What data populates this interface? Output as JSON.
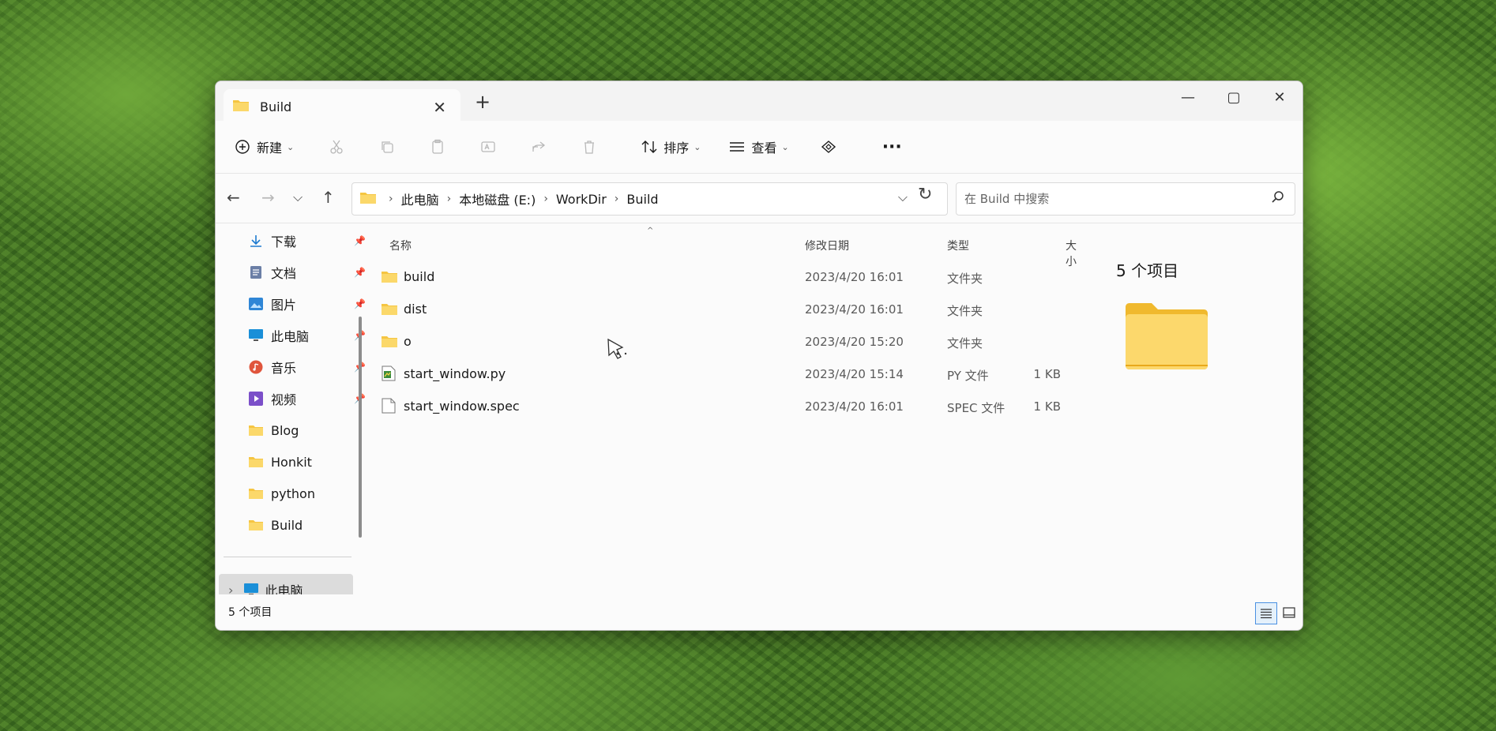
{
  "window": {
    "tab_title": "Build",
    "tab_close": "✕",
    "new_tab": "+",
    "controls": {
      "minimize": "—",
      "maximize": "▢",
      "close": "✕"
    }
  },
  "toolbar": {
    "new_label": "新建",
    "sort_label": "排序",
    "view_label": "查看",
    "more_label": "···",
    "icons": [
      "add-icon",
      "cut-icon",
      "copy-icon",
      "paste-icon",
      "rename-icon",
      "share-icon",
      "delete-icon",
      "sort-icon",
      "view-icon",
      "filter-icon",
      "more-icon"
    ]
  },
  "address": {
    "crumbs": [
      "此电脑",
      "本地磁盘 (E:)",
      "WorkDir",
      "Build"
    ],
    "dropdown": "⌵",
    "refresh": "↻"
  },
  "search": {
    "placeholder": "在 Build 中搜索"
  },
  "sidebar": {
    "items": [
      {
        "label": "下载",
        "icon": "download-icon",
        "pinned": true
      },
      {
        "label": "文档",
        "icon": "document-icon",
        "pinned": true
      },
      {
        "label": "图片",
        "icon": "picture-icon",
        "pinned": true
      },
      {
        "label": "此电脑",
        "icon": "computer-icon",
        "pinned": true
      },
      {
        "label": "音乐",
        "icon": "music-icon",
        "pinned": true
      },
      {
        "label": "视频",
        "icon": "video-icon",
        "pinned": true
      },
      {
        "label": "Blog",
        "icon": "folder-icon",
        "pinned": false
      },
      {
        "label": "Honkit",
        "icon": "folder-icon",
        "pinned": false
      },
      {
        "label": "python",
        "icon": "folder-icon",
        "pinned": false
      },
      {
        "label": "Build",
        "icon": "folder-icon",
        "pinned": false
      }
    ],
    "this_pc": "此电脑",
    "expand": "›"
  },
  "columns": {
    "name": "名称",
    "date": "修改日期",
    "type": "类型",
    "size": "大小",
    "sort_caret": "^"
  },
  "files": [
    {
      "name": "build",
      "date": "2023/4/20 16:01",
      "type": "文件夹",
      "size": ""
    },
    {
      "name": "dist",
      "date": "2023/4/20 16:01",
      "type": "文件夹",
      "size": ""
    },
    {
      "name": "o",
      "date": "2023/4/20 15:20",
      "type": "文件夹",
      "size": ""
    },
    {
      "name": "start_window.py",
      "date": "2023/4/20 15:14",
      "type": "PY 文件",
      "size": "1 KB"
    },
    {
      "name": "start_window.spec",
      "date": "2023/4/20 16:01",
      "type": "SPEC 文件",
      "size": "1 KB"
    }
  ],
  "details": {
    "title": "5 个项目"
  },
  "status": {
    "text": "5 个项目"
  },
  "colors": {
    "folder": "#f5c542",
    "folder_light": "#fbd86a",
    "accent": "#0067c0"
  }
}
